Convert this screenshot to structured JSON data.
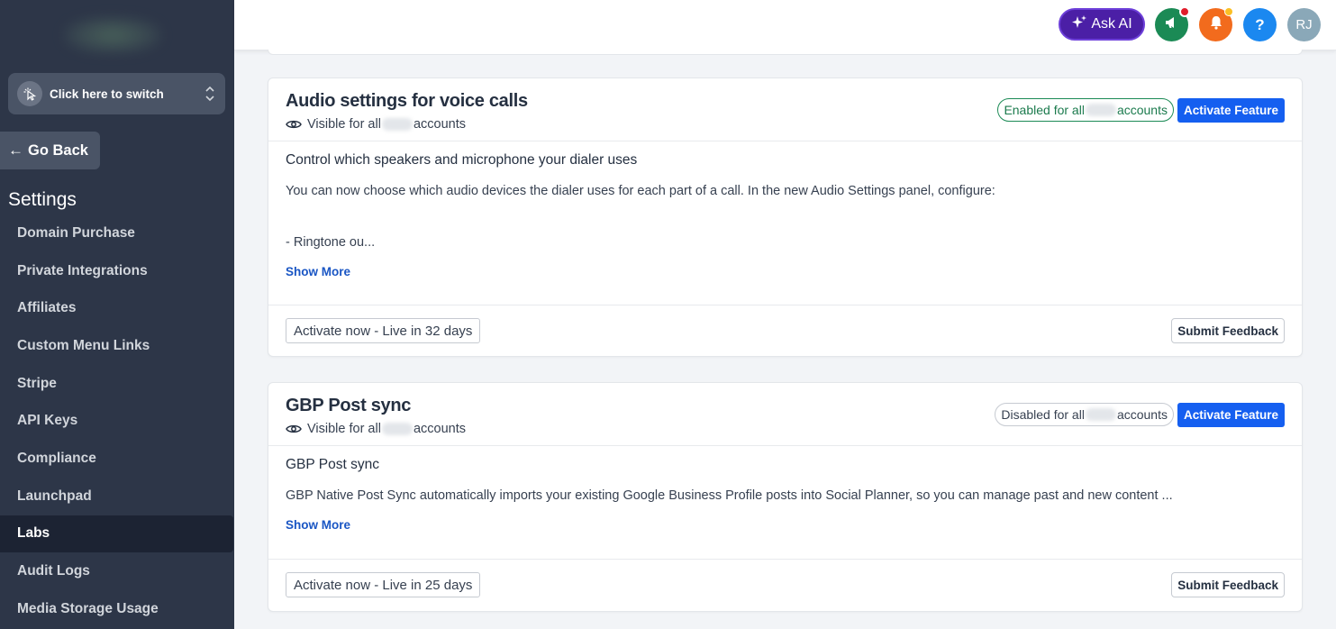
{
  "sidebar": {
    "switcher_label": "Click here to switch",
    "go_back_label": "Go Back",
    "section_title": "Settings",
    "items": [
      {
        "label": "Domain Purchase",
        "active": false
      },
      {
        "label": "Private Integrations",
        "active": false
      },
      {
        "label": "Affiliates",
        "active": false
      },
      {
        "label": "Custom Menu Links",
        "active": false
      },
      {
        "label": "Stripe",
        "active": false
      },
      {
        "label": "API Keys",
        "active": false
      },
      {
        "label": "Compliance",
        "active": false
      },
      {
        "label": "Launchpad",
        "active": false
      },
      {
        "label": "Labs",
        "active": true
      },
      {
        "label": "Audit Logs",
        "active": false
      },
      {
        "label": "Media Storage Usage",
        "active": false
      }
    ]
  },
  "header": {
    "ask_ai_label": "Ask AI",
    "help_label": "?",
    "avatar_initials": "RJ",
    "colors": {
      "ask_ai": "#4b1fa6",
      "announce": "#1b8a55",
      "bell": "#f26b1d",
      "help": "#1b88f0",
      "avatar": "#8aa8b8"
    }
  },
  "features": [
    {
      "title": "Audio settings for voice calls",
      "visible_prefix": "Visible for all",
      "visible_suffix": "accounts",
      "status_prefix": "Enabled for all",
      "status_suffix": "accounts",
      "status": "enabled",
      "activate_label": "Activate Feature",
      "body_heading": "Control which speakers and microphone your dialer uses",
      "body_text_1": "You can now choose which audio devices the dialer uses for each part of a call. In the new Audio Settings panel, configure:",
      "body_text_2": "- Ringtone ou...",
      "show_more": "Show More",
      "live_label": "Activate now - Live in 32 days",
      "feedback_label": "Submit Feedback"
    },
    {
      "title": "GBP Post sync",
      "visible_prefix": "Visible for all",
      "visible_suffix": "accounts",
      "status_prefix": "Disabled for all",
      "status_suffix": "accounts",
      "status": "disabled",
      "activate_label": "Activate Feature",
      "body_heading": "GBP Post sync",
      "body_text_1": "GBP Native Post Sync automatically imports your existing Google Business Profile posts into Social Planner, so you can manage past and new content ...",
      "show_more": "Show More",
      "live_label": "Activate now - Live in 25 days",
      "feedback_label": "Submit Feedback"
    }
  ]
}
